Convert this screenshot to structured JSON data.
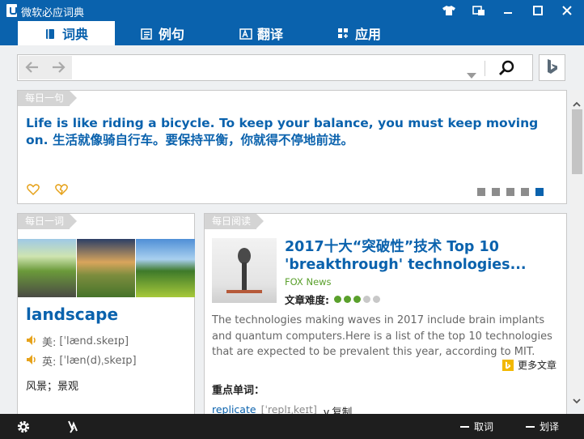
{
  "app": {
    "title": "微软必应词典"
  },
  "tabs": [
    {
      "label": "词典",
      "icon": "book-icon",
      "active": true
    },
    {
      "label": "例句",
      "icon": "list-icon",
      "active": false
    },
    {
      "label": "翻译",
      "icon": "translate-icon",
      "active": false
    },
    {
      "label": "应用",
      "icon": "apps-icon",
      "active": false
    }
  ],
  "search": {
    "query": "",
    "placeholder": ""
  },
  "daily_sentence": {
    "header": "每日一句",
    "text": "Life is like riding a bicycle. To keep your balance, you must keep moving on. 生活就像骑自行车。要保持平衡，你就得不停地前进。",
    "carousel": {
      "pages": 5,
      "current": 5
    }
  },
  "daily_word": {
    "header": "每日一词",
    "word": "landscape",
    "us_label": "美:",
    "us_pron": "[ˈlænd.skeɪp]",
    "uk_label": "英:",
    "uk_pron": "[ˈlæn(d)ˌskeɪp]",
    "meaning": "风景；景观"
  },
  "daily_reading": {
    "header": "每日阅读",
    "title": "2017十大“突破性”技术  Top 10 'breakthrough' technologies...",
    "source": "FOX News",
    "difficulty_label": "文章难度:",
    "difficulty_rating": 3,
    "difficulty_max": 5,
    "summary": "The technologies making waves in 2017 include brain implants and quantum computers.Here is a list of the top 10 technologies that are expected to be prevalent this year, according to MIT.",
    "more_label": "更多文章",
    "key_words_label": "重点单词：",
    "vocab": [
      {
        "word": "replicate",
        "pron": "[ˈreplɪˌkeɪt]",
        "meaning": "v.复制"
      }
    ]
  },
  "bottom": {
    "fetch_word": "取词",
    "translate_selection": "划译"
  },
  "colors": {
    "brand": "#0a62ad",
    "star_on": "#5aa02c",
    "star_off": "#c8c8c8",
    "accent_bing": "#f2b800"
  }
}
